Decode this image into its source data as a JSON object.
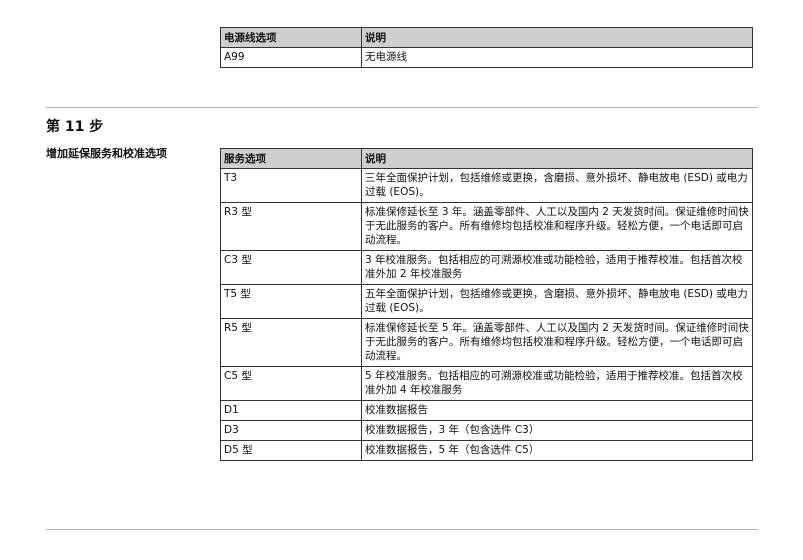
{
  "power_table": {
    "headers": [
      "电源线选项",
      "说明"
    ],
    "rows": [
      [
        "A99",
        "无电源线"
      ]
    ]
  },
  "step_heading": "第 11 步",
  "section_label": "增加延保服务和校准选项",
  "service_table": {
    "headers": [
      "服务选项",
      "说明"
    ],
    "rows": [
      [
        "T3",
        "三年全面保护计划，包括维修或更换，含磨损、意外损坏、静电放电 (ESD) 或电力过载 (EOS)。"
      ],
      [
        "R3 型",
        "标准保修延长至 3 年。涵盖零部件、人工以及国内 2 天发货时间。保证维修时间快于无此服务的客户。所有维修均包括校准和程序升级。轻松方便，一个电话即可启动流程。"
      ],
      [
        "C3 型",
        "3 年校准服务。包括相应的可溯源校准或功能检验，适用于推荐校准。包括首次校准外加 2 年校准服务"
      ],
      [
        "T5 型",
        "五年全面保护计划，包括维修或更换，含磨损、意外损坏、静电放电 (ESD) 或电力过载 (EOS)。"
      ],
      [
        "R5 型",
        "标准保修延长至 5 年。涵盖零部件、人工以及国内 2 天发货时间。保证维修时间快于无此服务的客户。所有维修均包括校准和程序升级。轻松方便，一个电话即可启动流程。"
      ],
      [
        "C5 型",
        "5 年校准服务。包括相应的可溯源校准或功能检验，适用于推荐校准。包括首次校准外加 4 年校准服务"
      ],
      [
        "D1",
        "校准数据报告"
      ],
      [
        "D3",
        "校准数据报告，3 年（包含选件 C3）"
      ],
      [
        "D5 型",
        "校准数据报告，5 年（包含选件 C5）"
      ]
    ]
  }
}
